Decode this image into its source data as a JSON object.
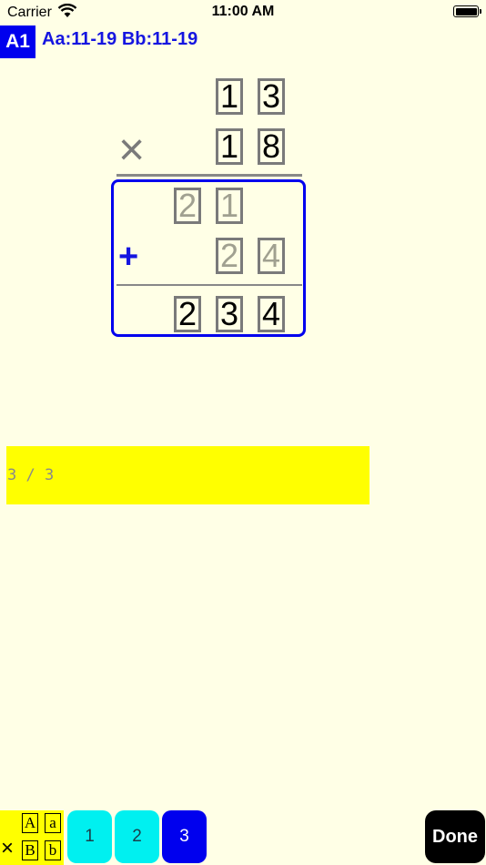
{
  "status_bar": {
    "carrier": "Carrier",
    "time": "11:00 AM",
    "wifi_icon": "wifi-icon",
    "battery_icon": "battery-icon"
  },
  "header": {
    "level": "A1",
    "range": "Aa:11-19 Bb:11-19"
  },
  "problem": {
    "multiplicand": [
      "1",
      "3"
    ],
    "multiplier": [
      "1",
      "8"
    ],
    "operator": "×",
    "partial_1": [
      "2",
      "1"
    ],
    "partial_2": [
      "2",
      "4"
    ],
    "plus": "+",
    "answer": [
      "2",
      "3",
      "4"
    ]
  },
  "progress": {
    "text": "3 / 3",
    "fraction": 1.0
  },
  "toolbar": {
    "mode_icon": {
      "boxes": [
        "A",
        "a",
        "B",
        "b"
      ],
      "times": "×"
    },
    "pages": [
      "1",
      "2",
      "3"
    ],
    "active_page": "3",
    "done_label": "Done"
  },
  "colors": {
    "background": "#ffffe6",
    "accent_blue": "#0000ee",
    "yellow": "#ffff00",
    "cyan": "#00f0f0"
  }
}
